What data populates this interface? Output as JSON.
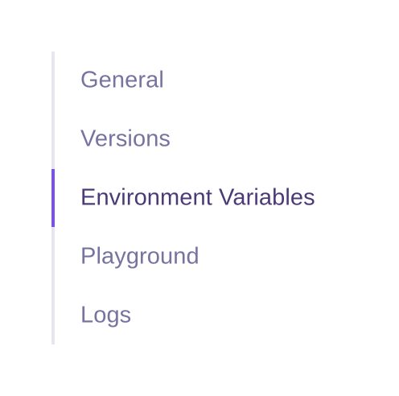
{
  "colors": {
    "track": "#e6e6ee",
    "active_indicator": "#7a54e0",
    "item_text": "#7673a0",
    "active_text": "#4b3a78"
  },
  "nav": {
    "active_index": 2,
    "items": [
      {
        "label": "General"
      },
      {
        "label": "Versions"
      },
      {
        "label": "Environment Variables"
      },
      {
        "label": "Playground"
      },
      {
        "label": "Logs"
      }
    ]
  }
}
